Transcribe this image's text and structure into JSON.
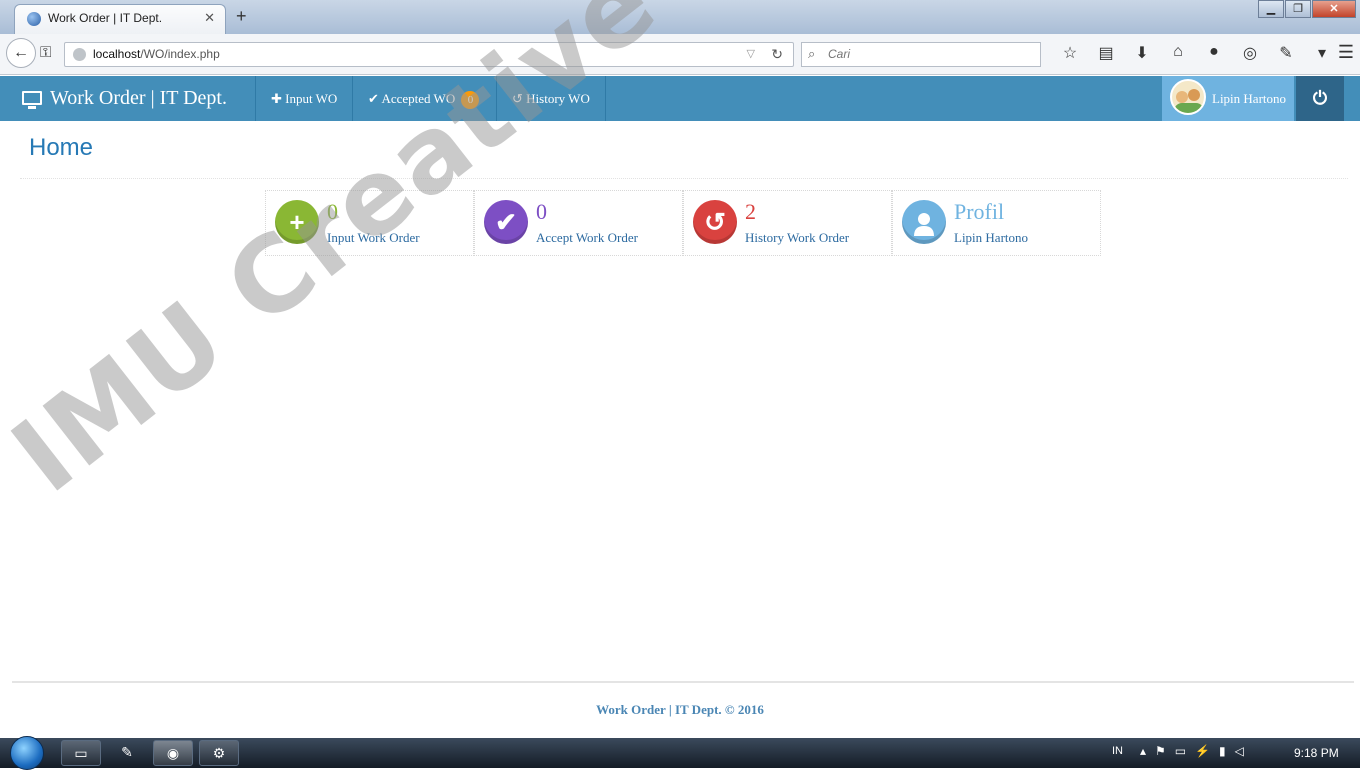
{
  "browser": {
    "tab_title": "Work Order | IT Dept.",
    "close_glyph": "✕",
    "new_tab_glyph": "+",
    "url_host": "localhost",
    "url_path": "/WO/index.php",
    "search_placeholder": "Cari"
  },
  "app": {
    "brand": "Work Order | IT Dept.",
    "nav": [
      {
        "label": "Input WO",
        "icon": "plus-icon"
      },
      {
        "label": "Accepted WO",
        "icon": "check-icon",
        "badge": "0"
      },
      {
        "label": "History WO",
        "icon": "history-icon"
      }
    ],
    "user_name": "Lipin Hartono",
    "power_icon": "power-icon"
  },
  "page": {
    "title": "Home",
    "stats": [
      {
        "value": "0",
        "label": "Input Work Order",
        "icon": "plus-icon",
        "color": "#8ab734",
        "value_color": "#8ab734"
      },
      {
        "value": "0",
        "label": "Accept Work Order",
        "icon": "check-icon",
        "color": "#7d4fc4",
        "value_color": "#7d4fc4"
      },
      {
        "value": "2",
        "label": "History Work Order",
        "icon": "history-icon",
        "color": "#d9423f",
        "value_color": "#d9423f"
      },
      {
        "value": "Profil",
        "label": "Lipin Hartono",
        "icon": "user-icon",
        "color": "#6fb3e0",
        "value_color": "#6fb3e0"
      }
    ]
  },
  "watermark": "IMU Creative",
  "footer": "Work Order | IT Dept. © 2016",
  "taskbar": {
    "language": "IN",
    "clock": "9:18 PM"
  },
  "colors": {
    "header": "#438eb9",
    "user_box": "#6fb3e0",
    "power_box": "#2e6589",
    "badge": "#f79a0e"
  }
}
